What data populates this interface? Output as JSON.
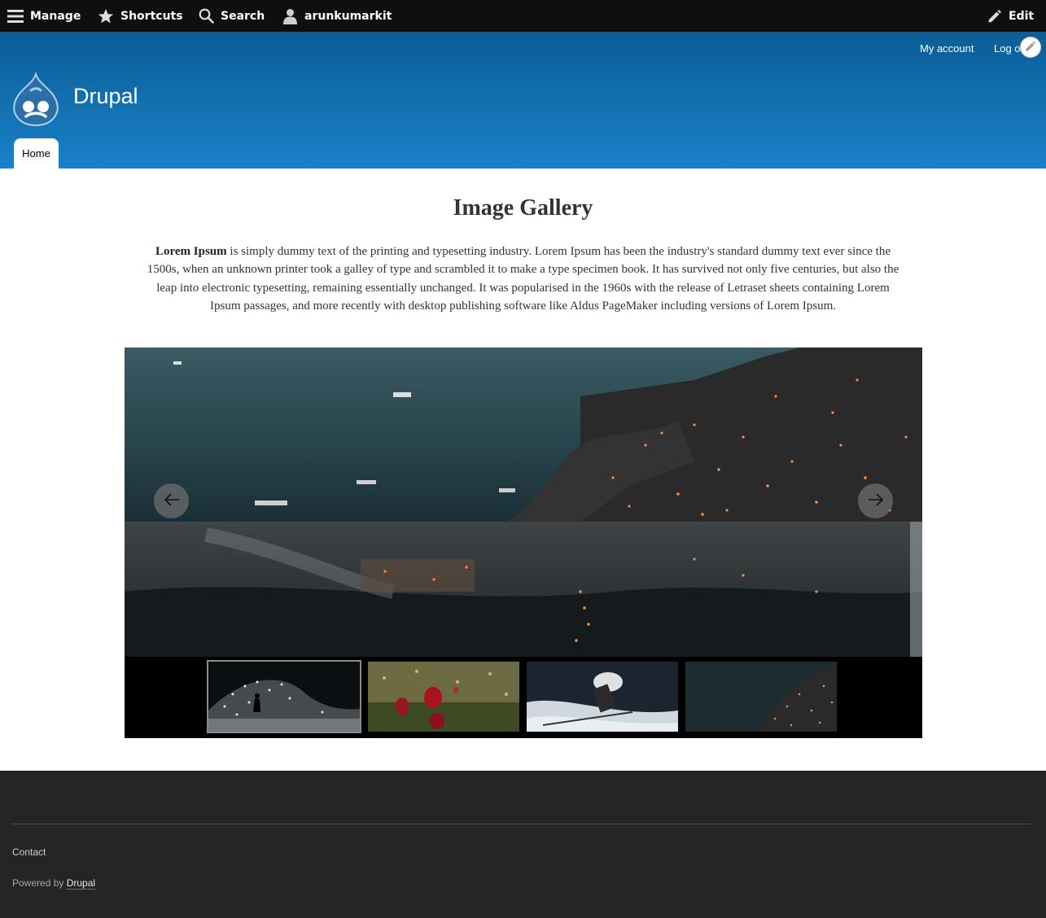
{
  "toolbar": {
    "manage": "Manage",
    "shortcuts": "Shortcuts",
    "search": "Search",
    "user": "arunkumarkit",
    "edit": "Edit"
  },
  "header": {
    "site_name": "Drupal",
    "my_account": "My account",
    "log_out": "Log out",
    "tabs": [
      {
        "label": "Home"
      }
    ]
  },
  "main": {
    "title": "Image Gallery",
    "intro_bold": "Lorem Ipsum",
    "intro_text": " is simply dummy text of the printing and typesetting industry. Lorem Ipsum has been the industry's standard dummy text ever since the 1500s, when an unknown printer took a galley of type and scrambled it to make a type specimen book. It has survived not only five centuries, but also the leap into electronic typesetting, remaining essentially unchanged. It was popularised in the 1960s with the release of Letraset sheets containing Lorem Ipsum passages, and more recently with desktop publishing software like Aldus PageMaker including versions of Lorem Ipsum."
  },
  "gallery": {
    "thumbnails": [
      {
        "icon": "water-ski-photo",
        "active": true
      },
      {
        "icon": "red-flowers-photo",
        "active": false
      },
      {
        "icon": "skier-photo",
        "active": false
      },
      {
        "icon": "coastal-city-night-photo",
        "active": false
      }
    ]
  },
  "footer": {
    "contact": "Contact",
    "powered_prefix": "Powered by ",
    "powered_link": "Drupal"
  },
  "colors": {
    "toolbar_bg": "#0f0f0f",
    "header_top": "#0b5d97",
    "header_bottom": "#1a81c8",
    "footer_bg": "#252525"
  }
}
